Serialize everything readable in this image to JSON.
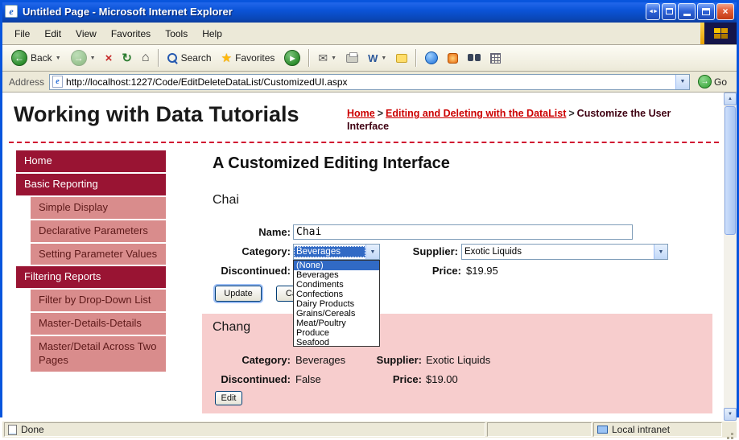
{
  "window": {
    "title": "Untitled Page - Microsoft Internet Explorer"
  },
  "icons": {
    "back_arrow": "←",
    "forward_arrow": "→",
    "stop_x": "×",
    "refresh": "↻",
    "home": "⌂",
    "star": "★",
    "play": "▶",
    "chevron_down": "▼",
    "envelope": "✉",
    "word_w": "W",
    "go_arrow": "→",
    "close_x": "×",
    "left_right": "◄►",
    "scroll_up": "▲",
    "scroll_down": "▼"
  },
  "menu": {
    "items": [
      "File",
      "Edit",
      "View",
      "Favorites",
      "Tools",
      "Help"
    ]
  },
  "toolbar": {
    "back_label": "Back",
    "search_label": "Search",
    "favorites_label": "Favorites"
  },
  "address_bar": {
    "label": "Address",
    "url": "http://localhost:1227/Code/EditDeleteDataList/CustomizedUI.aspx",
    "go_label": "Go"
  },
  "page": {
    "site_title": "Working with Data Tutorials",
    "breadcrumb": {
      "home": "Home",
      "sep": ">",
      "section": "Editing and Deleting with the DataList",
      "current": "Customize the User Interface"
    },
    "sidebar": [
      {
        "label": "Home",
        "level": 0
      },
      {
        "label": "Basic Reporting",
        "level": 0
      },
      {
        "label": "Simple Display",
        "level": 1
      },
      {
        "label": "Declarative Parameters",
        "level": 1
      },
      {
        "label": "Setting Parameter Values",
        "level": 1
      },
      {
        "label": "Filtering Reports",
        "level": 0
      },
      {
        "label": "Filter by Drop-Down List",
        "level": 1
      },
      {
        "label": "Master-Details-Details",
        "level": 1
      },
      {
        "label": "Master/Detail Across Two Pages",
        "level": 1
      }
    ],
    "heading": "A Customized Editing Interface",
    "edit_form": {
      "product_name": "Chai",
      "name_label": "Name:",
      "name_value": "Chai",
      "category_label": "Category:",
      "category_value": "Beverages",
      "supplier_label": "Supplier:",
      "supplier_value": "Exotic Liquids",
      "discontinued_label": "Discontinued:",
      "price_label": "Price:",
      "price_value": "$19.95",
      "update_label": "Update",
      "cancel_label": "Cancel"
    },
    "category_dropdown": {
      "highlighted": "(None)",
      "options": [
        "(None)",
        "Beverages",
        "Condiments",
        "Confections",
        "Dairy Products",
        "Grains/Cereals",
        "Meat/Poultry",
        "Produce",
        "Seafood"
      ]
    },
    "item_view": {
      "product_name": "Chang",
      "category_label": "Category:",
      "category_value": "Beverages",
      "supplier_label": "Supplier:",
      "supplier_value": "Exotic Liquids",
      "discontinued_label": "Discontinued:",
      "discontinued_value": "False",
      "price_label": "Price:",
      "price_value": "$19.00",
      "edit_label": "Edit"
    }
  },
  "status_bar": {
    "left": "Done",
    "right": "Local intranet"
  },
  "colors": {
    "accent_maroon": "#991433",
    "sidebar_light": "#D98C8C",
    "link_red": "#CC0000",
    "panel_pink": "#F7CDCD",
    "selection_blue": "#316AC5",
    "titlebar_blue": "#0B54D8"
  }
}
